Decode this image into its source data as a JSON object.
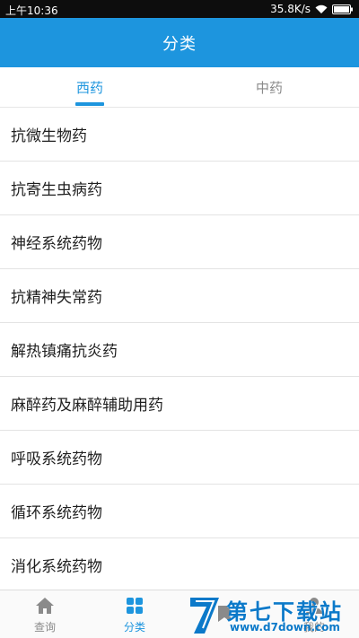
{
  "status_bar": {
    "time": "上午10:36",
    "network_speed": "35.8K/s"
  },
  "app_bar": {
    "title": "分类"
  },
  "tabs": [
    {
      "label": "西药",
      "active": true
    },
    {
      "label": "中药",
      "active": false
    }
  ],
  "categories": [
    "抗微生物药",
    "抗寄生虫病药",
    "神经系统药物",
    "抗精神失常药",
    "解热镇痛抗炎药",
    "麻醉药及麻醉辅助用药",
    "呼吸系统药物",
    "循环系统药物",
    "消化系统药物"
  ],
  "bottom_nav": [
    {
      "label": "查询",
      "icon": "home-icon",
      "active": false
    },
    {
      "label": "分类",
      "icon": "grid-icon",
      "active": true
    },
    {
      "label": "",
      "icon": "bookmark-icon",
      "active": false
    },
    {
      "label": "我的",
      "icon": "user-icon",
      "active": false
    }
  ],
  "watermark": {
    "text": "第七下载站",
    "url": "www.d7down.com"
  },
  "colors": {
    "accent": "#1d95de",
    "status_bar": "#0d0d0d",
    "inactive": "#8a8a8a"
  }
}
